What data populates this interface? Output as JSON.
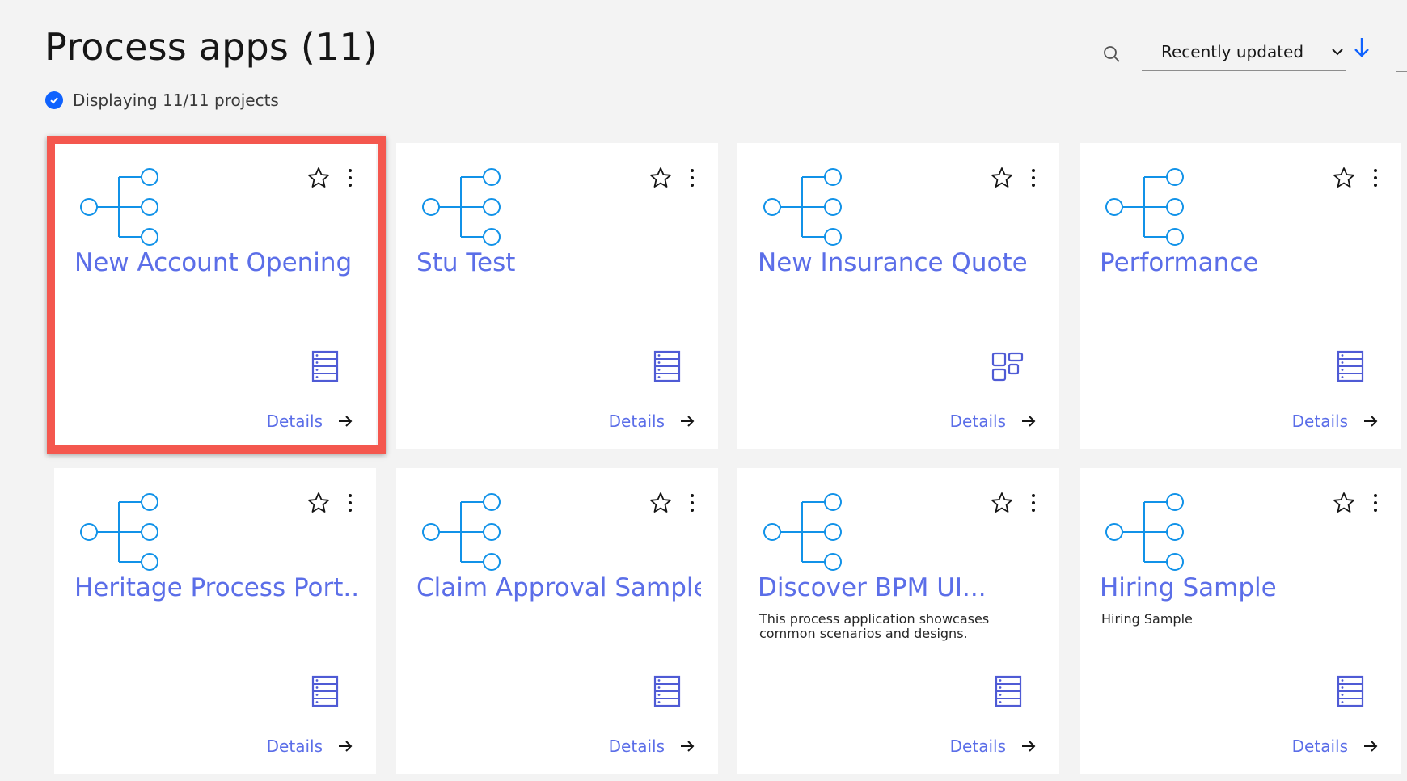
{
  "header": {
    "title": "Process apps (11)",
    "status_text": "Displaying 11/11 projects",
    "sort_label": "Recently updated"
  },
  "colors": {
    "accent": "#0f62fe",
    "link": "#5b6ee8",
    "icon_cyan": "#1192e8",
    "highlight": "#f4574e"
  },
  "cards": [
    {
      "name": "New Account Opening",
      "desc": "",
      "type_icon": "list-icon",
      "details": "Details"
    },
    {
      "name": "Stu Test",
      "desc": "",
      "type_icon": "list-icon",
      "details": "Details"
    },
    {
      "name": "New Insurance Quote",
      "desc": "",
      "type_icon": "grid-icon",
      "details": "Details"
    },
    {
      "name": "Performance",
      "desc": "",
      "type_icon": "list-icon",
      "details": "Details"
    },
    {
      "name": "Heritage Process Port...",
      "desc": "",
      "type_icon": "list-icon",
      "details": "Details"
    },
    {
      "name": "Claim Approval Sample",
      "desc": "",
      "type_icon": "list-icon",
      "details": "Details"
    },
    {
      "name": "Discover BPM UI...",
      "desc": "This process application showcases common scenarios and designs.",
      "type_icon": "list-icon",
      "details": "Details"
    },
    {
      "name": "Hiring Sample",
      "desc": "Hiring Sample",
      "type_icon": "list-icon",
      "details": "Details"
    }
  ]
}
